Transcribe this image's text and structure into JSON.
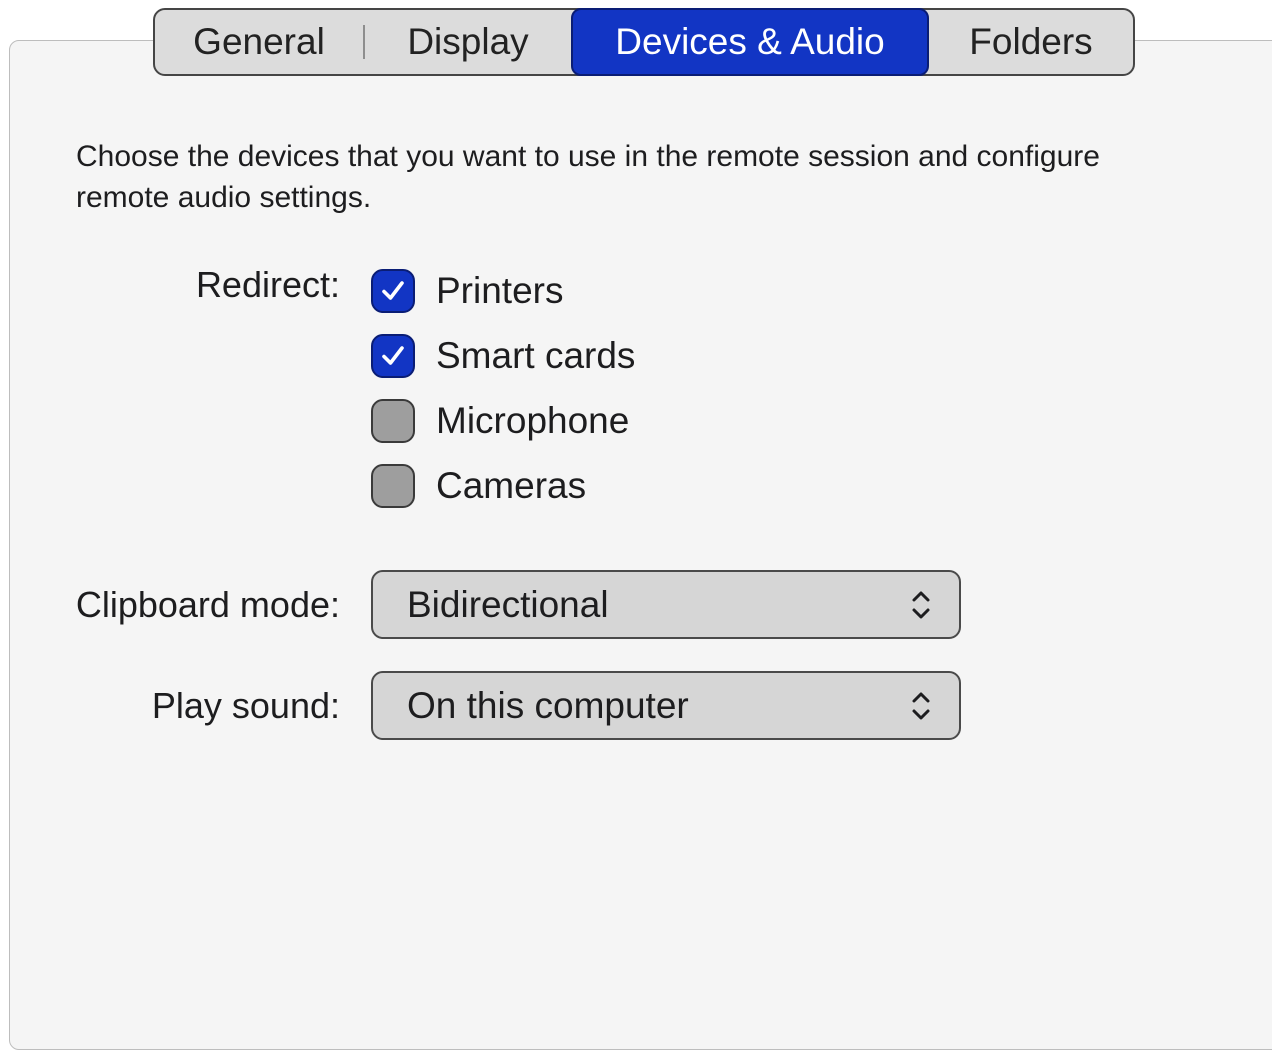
{
  "tabs": [
    {
      "label": "General",
      "selected": false
    },
    {
      "label": "Display",
      "selected": false
    },
    {
      "label": "Devices & Audio",
      "selected": true
    },
    {
      "label": "Folders",
      "selected": false
    }
  ],
  "description": "Choose the devices that you want to use in the remote session and configure remote audio settings.",
  "redirect": {
    "label": "Redirect:",
    "options": [
      {
        "label": "Printers",
        "checked": true
      },
      {
        "label": "Smart cards",
        "checked": true
      },
      {
        "label": "Microphone",
        "checked": false
      },
      {
        "label": "Cameras",
        "checked": false
      }
    ]
  },
  "clipboard": {
    "label": "Clipboard mode:",
    "value": "Bidirectional"
  },
  "sound": {
    "label": "Play sound:",
    "value": "On this computer"
  },
  "colors": {
    "accent": "#1235c4",
    "panel_background": "#f5f5f5",
    "unchecked_box": "#9e9e9e"
  },
  "icons": {
    "check": "checkmark-icon",
    "popup": "up-down-chevron-icon"
  }
}
